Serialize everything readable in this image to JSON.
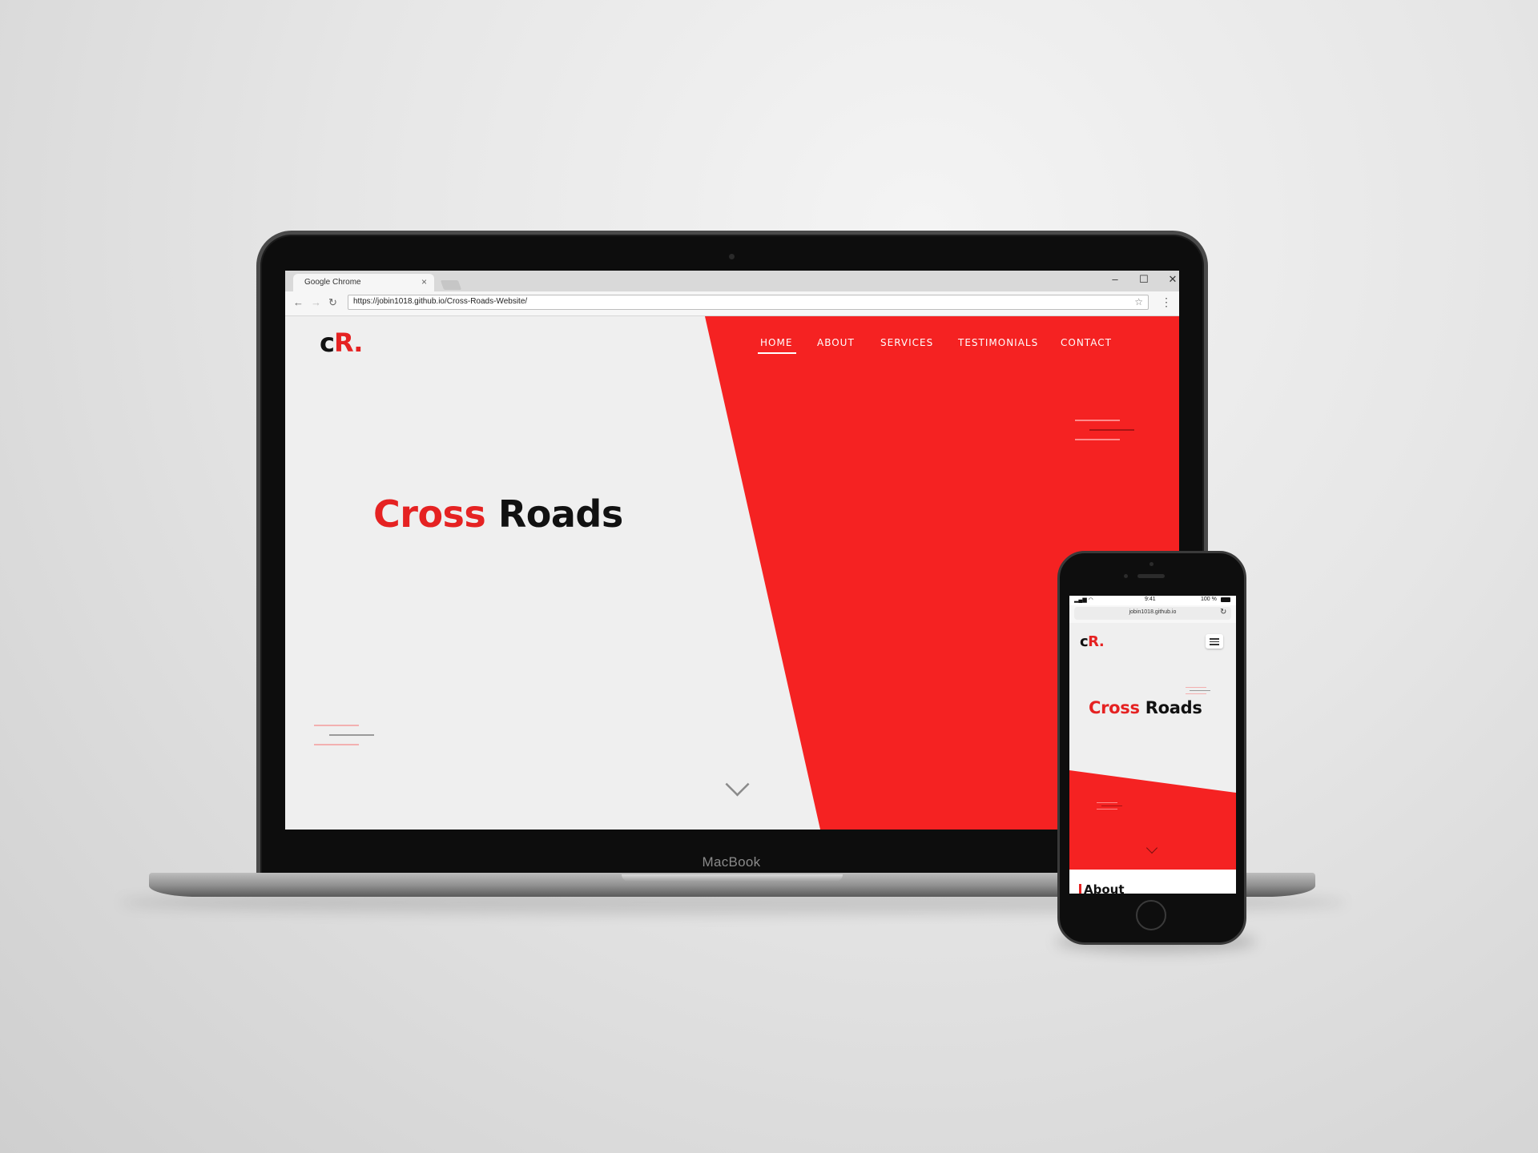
{
  "browser": {
    "tab_title": "Google Chrome",
    "tab_close": "×",
    "url": "https://jobin1018.github.io/Cross-Roads-Website/",
    "back": "←",
    "forward": "→",
    "reload": "↻",
    "star": "☆",
    "menu": "⋮",
    "minimize": "–",
    "maximize": "☐",
    "close": "✕"
  },
  "site": {
    "logo_c": "c",
    "logo_r": "R.",
    "nav": [
      "HOME",
      "ABOUT",
      "SERVICES",
      "TESTIMONIALS",
      "CONTACT"
    ],
    "hero_word1": "Cross",
    "hero_word2": "Roads"
  },
  "device": {
    "laptop_label": "MacBook"
  },
  "phone": {
    "time": "9:41",
    "battery": "100 %",
    "url": "jobin1018.github.io",
    "reload": "↻",
    "logo_c": "c",
    "logo_r": "R.",
    "hero_word1": "Cross",
    "hero_word2": "Roads",
    "section_title": "About"
  },
  "colors": {
    "accent": "#f52222",
    "logo_red": "#e52222",
    "page_bg": "#efefef"
  }
}
